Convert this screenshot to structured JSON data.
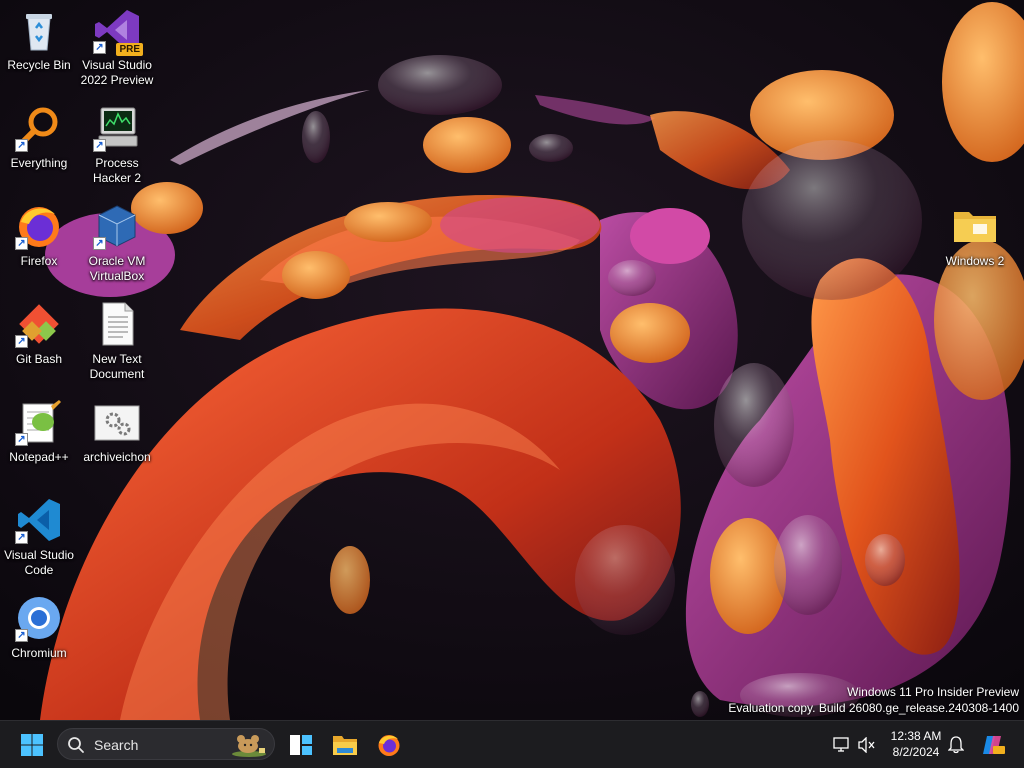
{
  "desktop": {
    "icons": [
      {
        "label": "Recycle Bin",
        "icon": "recycle-bin-icon"
      },
      {
        "label": "Visual Studio\n2022 Preview",
        "icon": "visual-studio-preview-icon",
        "badge": "PRE"
      },
      {
        "label": "Everything",
        "icon": "everything-search-icon"
      },
      {
        "label": "Process\nHacker 2",
        "icon": "process-hacker-icon"
      },
      {
        "label": "Firefox",
        "icon": "firefox-icon"
      },
      {
        "label": "Oracle VM\nVirtualBox",
        "icon": "virtualbox-icon"
      },
      {
        "label": "Git Bash",
        "icon": "git-bash-icon"
      },
      {
        "label": "New Text\nDocument",
        "icon": "text-document-icon"
      },
      {
        "label": "Notepad++",
        "icon": "notepad-plus-plus-icon"
      },
      {
        "label": "archiveichon",
        "icon": "settings-file-icon"
      },
      {
        "label": "Visual Studio\nCode",
        "icon": "vscode-icon"
      },
      {
        "label": "Chromium",
        "icon": "chromium-icon"
      },
      {
        "label": "Windows 2",
        "icon": "folder-icon"
      }
    ]
  },
  "watermark": {
    "line1": "Windows 11 Pro Insider Preview",
    "line2": "Evaluation copy. Build 26080.ge_release.240308-1400"
  },
  "taskbar": {
    "search_placeholder": "Search",
    "pinned": [
      "start-icon",
      "task-view-icon",
      "file-explorer-icon",
      "firefox-icon"
    ],
    "clock": {
      "time": "12:38 AM",
      "date": "8/2/2024"
    },
    "colors": {
      "background": "#1c1c1f",
      "accent": "#4cc2ff"
    }
  }
}
